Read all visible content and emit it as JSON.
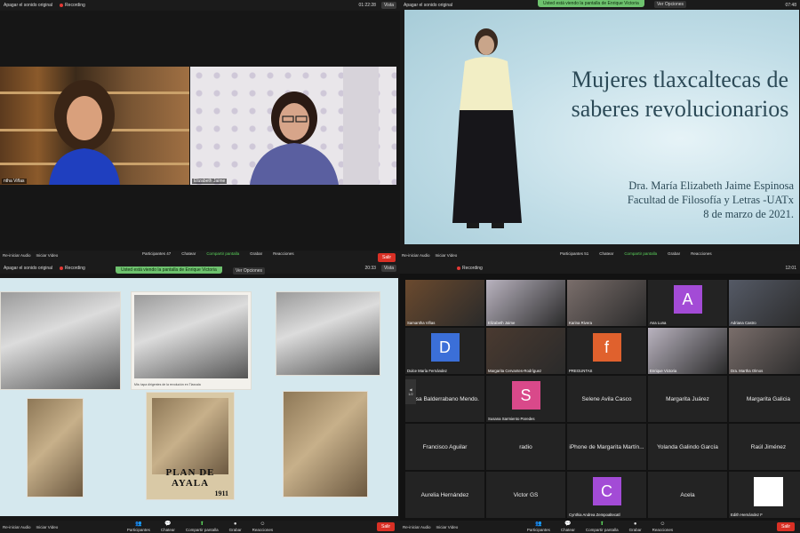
{
  "q1": {
    "top_audio": "Apagar el sonido original",
    "recording": "Recording",
    "time": "01:22:28",
    "view": "Vista",
    "cam1_name": "ntha Viñas",
    "cam2_name": "Elizabeth Jaime"
  },
  "q2": {
    "top_audio": "Apagar el sonido original",
    "banner": "Usted está viendo la pantalla de Enrique Victoria",
    "view_options": "Ver Opciones",
    "time": "07:48",
    "slide_title": "Mujeres tlaxcaltecas de saberes revolucionarios",
    "slide_author": "Dra. María Elizabeth Jaime Espinosa",
    "slide_faculty": "Facultad de Filosofía y Letras -UATx",
    "slide_date": "8  de marzo  de 2021."
  },
  "controls": {
    "reactivar_audio": "Re-iniciar Audio",
    "iniciar_video": "Iniciar Video",
    "participants": "Participantes",
    "participants_count_left": "47",
    "participants_count_right": "51",
    "participants_count_bottom": "46",
    "chat": "Chatear",
    "share": "Compartir pantalla",
    "record": "Grabar",
    "reactions": "Reacciones",
    "leave": "Salir"
  },
  "q3": {
    "top_audio": "Apagar el sonido original",
    "recording": "Recording",
    "banner": "Usted está viendo la pantalla de Enrique Victoria",
    "view_options": "Ver Opciones",
    "time": "20:33",
    "view": "Vista",
    "photo_caption": "Mis: tapa dirigentes de la revolución en Tlaxcala",
    "plan_text": "PLAN DE AYALA",
    "year": "1911"
  },
  "q4": {
    "recording": "Recording",
    "time": "12:01",
    "pager": "1/2",
    "tiles": [
      {
        "kind": "video",
        "name": "Samantha Viñas"
      },
      {
        "kind": "video",
        "name": "Elizabeth Jaime"
      },
      {
        "kind": "video",
        "name": "Karina Rivera"
      },
      {
        "kind": "avatar",
        "letter": "A",
        "color": "#a34bd6",
        "name": "Ana Luna"
      },
      {
        "kind": "video",
        "name": "Adriana Castro"
      },
      {
        "kind": "avatar",
        "letter": "D",
        "color": "#3b6fd8",
        "name": "Dulce María Fernández"
      },
      {
        "kind": "video",
        "name": "Margarita Cervantes-Rodríguez"
      },
      {
        "kind": "avatar",
        "letter": "f",
        "color": "#e0612d",
        "name": "PREGUNTAS"
      },
      {
        "kind": "video",
        "name": "Enrique Victoria"
      },
      {
        "kind": "video",
        "name": "Dra. Martha Olmos"
      },
      {
        "kind": "label",
        "label": "resa Balderrabano Mendo."
      },
      {
        "kind": "avatar",
        "letter": "S",
        "color": "#d9498a",
        "name": "Susana Sarmiento Paredes"
      },
      {
        "kind": "label",
        "label": "Selene Avila Casco"
      },
      {
        "kind": "label",
        "label": "Margarita Juárez"
      },
      {
        "kind": "label",
        "label": "Margarita Galicia"
      },
      {
        "kind": "label",
        "label": "Francisco Aguilar"
      },
      {
        "kind": "label",
        "label": "radio"
      },
      {
        "kind": "label",
        "label": "iPhone de Margarita Martín..."
      },
      {
        "kind": "label",
        "label": "Yolanda Galindo García"
      },
      {
        "kind": "label",
        "label": "Raúl Jiménez"
      },
      {
        "kind": "label",
        "label": "Aurelia Hernández"
      },
      {
        "kind": "label",
        "label": "Victor GS"
      },
      {
        "kind": "avatar",
        "letter": "C",
        "color": "#a34bd6",
        "name": "Cynthia Andrea Zempoaltecatl"
      },
      {
        "kind": "label",
        "label": "Acela"
      },
      {
        "kind": "white",
        "name": "Edith Hernández F"
      }
    ]
  }
}
